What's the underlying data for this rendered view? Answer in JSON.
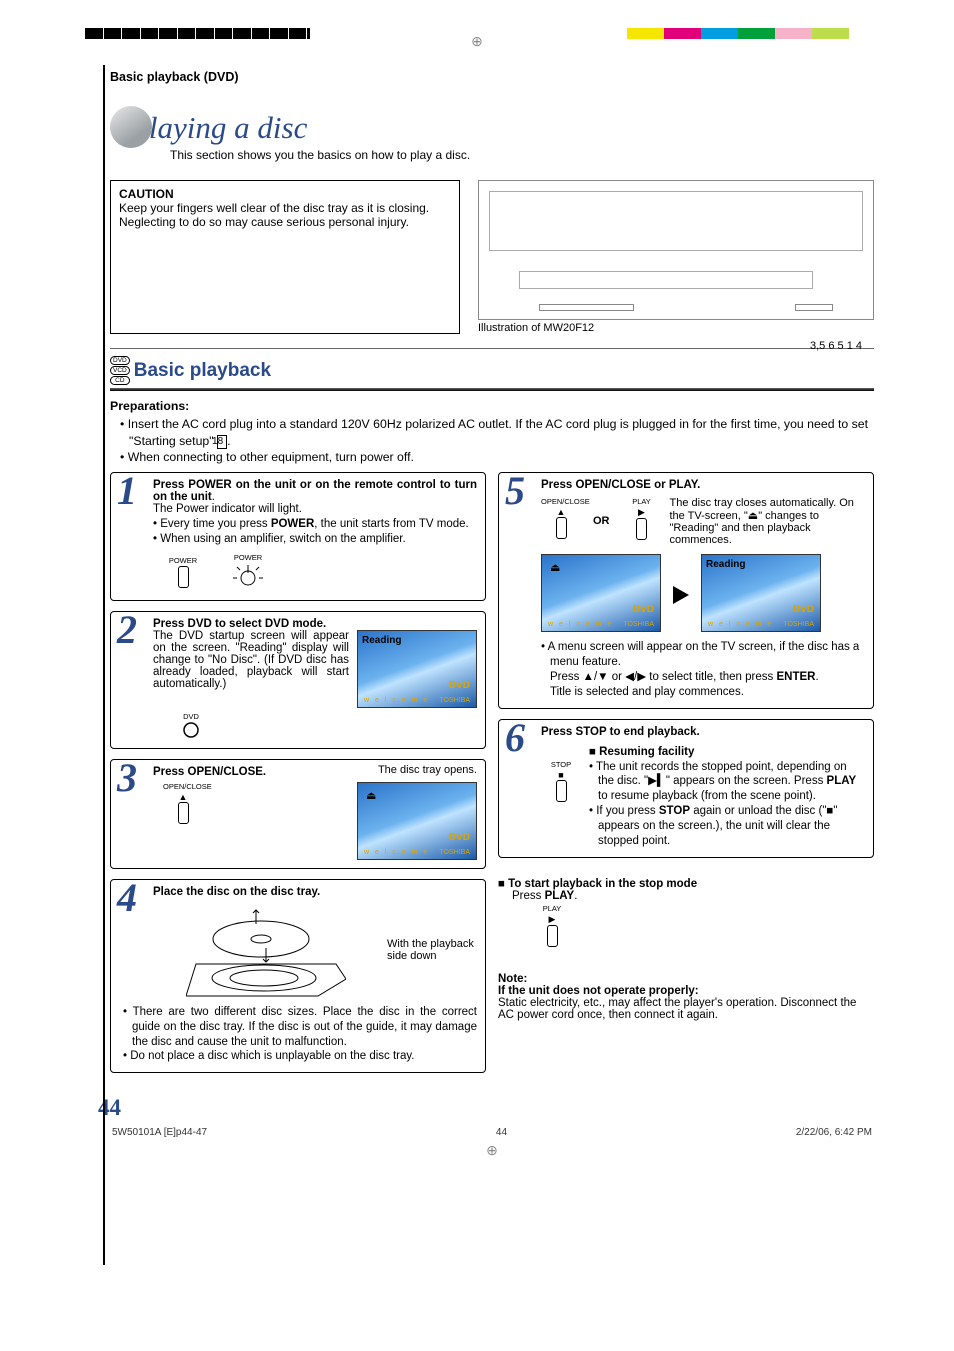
{
  "breadcrumb": "Basic playback (DVD)",
  "title": "Playing a disc",
  "intro": "This section shows you the basics on how to play a disc.",
  "caution": {
    "heading": "CAUTION",
    "body": "Keep your fingers well clear of the disc tray as it is closing. Neglecting to do so may cause serious personal injury."
  },
  "illustration": {
    "caption": "Illustration of MW20F12",
    "callouts": "3,5   6 5 1   4"
  },
  "disc_badges": [
    "DVD",
    "VCD",
    "CD"
  ],
  "section_title": "Basic playback",
  "preparations": {
    "heading": "Preparations:",
    "items": [
      "Insert the AC cord plug into a standard 120V 60Hz polarized AC outlet. If the AC cord plug is plugged in for the first time, you need to set \"Starting setup\"",
      "When connecting to other equipment, turn power off."
    ],
    "page_ref": "18"
  },
  "steps": {
    "s1": {
      "lead1": "Press POWER on the unit or on the remote control to turn on the unit",
      "line1": "The Power indicator will light.",
      "b1a": "Every time you press",
      "b1b": "POWER",
      "b1c": ", the unit starts from TV mode.",
      "b2": "When using an amplifier, switch on the amplifier.",
      "pwr_label": "POWER"
    },
    "s2": {
      "lead": "Press DVD to select DVD mode.",
      "body": "The DVD startup screen will appear on the screen. \"Reading\" display will change to \"No Disc\". (If DVD disc has already loaded, playback will start automatically.)",
      "dvd_label": "DVD",
      "reading": "Reading"
    },
    "s3": {
      "lead": "Press OPEN/CLOSE.",
      "body": "The disc tray opens.",
      "oc_label": "OPEN/CLOSE"
    },
    "s4": {
      "lead": "Place the disc on the disc tray.",
      "side": "With the playback side down",
      "n1": "There are two different disc sizes. Place the disc in the correct guide on the disc tray. If the disc is out of the guide, it may damage the disc and cause the unit to malfunction.",
      "n2": "Do not place a disc which is unplayable on the disc tray."
    },
    "s5": {
      "lead": "Press OPEN/CLOSE or PLAY.",
      "oc_label": "OPEN/CLOSE",
      "play_label": "PLAY",
      "or": "OR",
      "p1": "The disc tray closes automatically. On the TV-screen, \"",
      "p2": "\" changes to \"Reading\" and then playback commences.",
      "reading": "Reading",
      "m1": "A menu screen will appear on the TV screen, if the disc has a menu feature.",
      "m2a": "Press ▲/▼ or ◀/▶ to select title, then press",
      "m2b": "ENTER",
      "m2c": ".",
      "m3": "Title is selected and play commences."
    },
    "s6": {
      "lead": "Press STOP to end playback.",
      "stop_label": "STOP",
      "resume_head": "Resuming facility",
      "r1a": "The unit records the stopped point, depending on the disc. \"",
      "r1b": "\" appears on the screen. Press",
      "r1c": "PLAY",
      "r1d": " to resume playback (from the scene point).",
      "r2a": "If you press",
      "r2b": "STOP",
      "r2c": " again or unload the disc (\"",
      "r2d": "\" appears on the screen.), the unit will clear the stopped point."
    }
  },
  "start_stop": {
    "head": "To start playback in the stop mode",
    "body_a": "Press",
    "body_b": "PLAY",
    "body_c": ".",
    "play_label": "PLAY"
  },
  "note": {
    "head": "Note:",
    "sub": "If the unit does not operate properly:",
    "body": "Static electricity, etc., may affect the player's operation. Disconnect the AC power cord once, then connect it again."
  },
  "screen": {
    "dvd": "DVD",
    "welcome": "w e l c o m e",
    "brand": "TOSHIBA"
  },
  "page_number": "44",
  "footer": {
    "left": "5W50101A [E]p44-47",
    "mid": "44",
    "right": "2/22/06, 6:42 PM"
  }
}
